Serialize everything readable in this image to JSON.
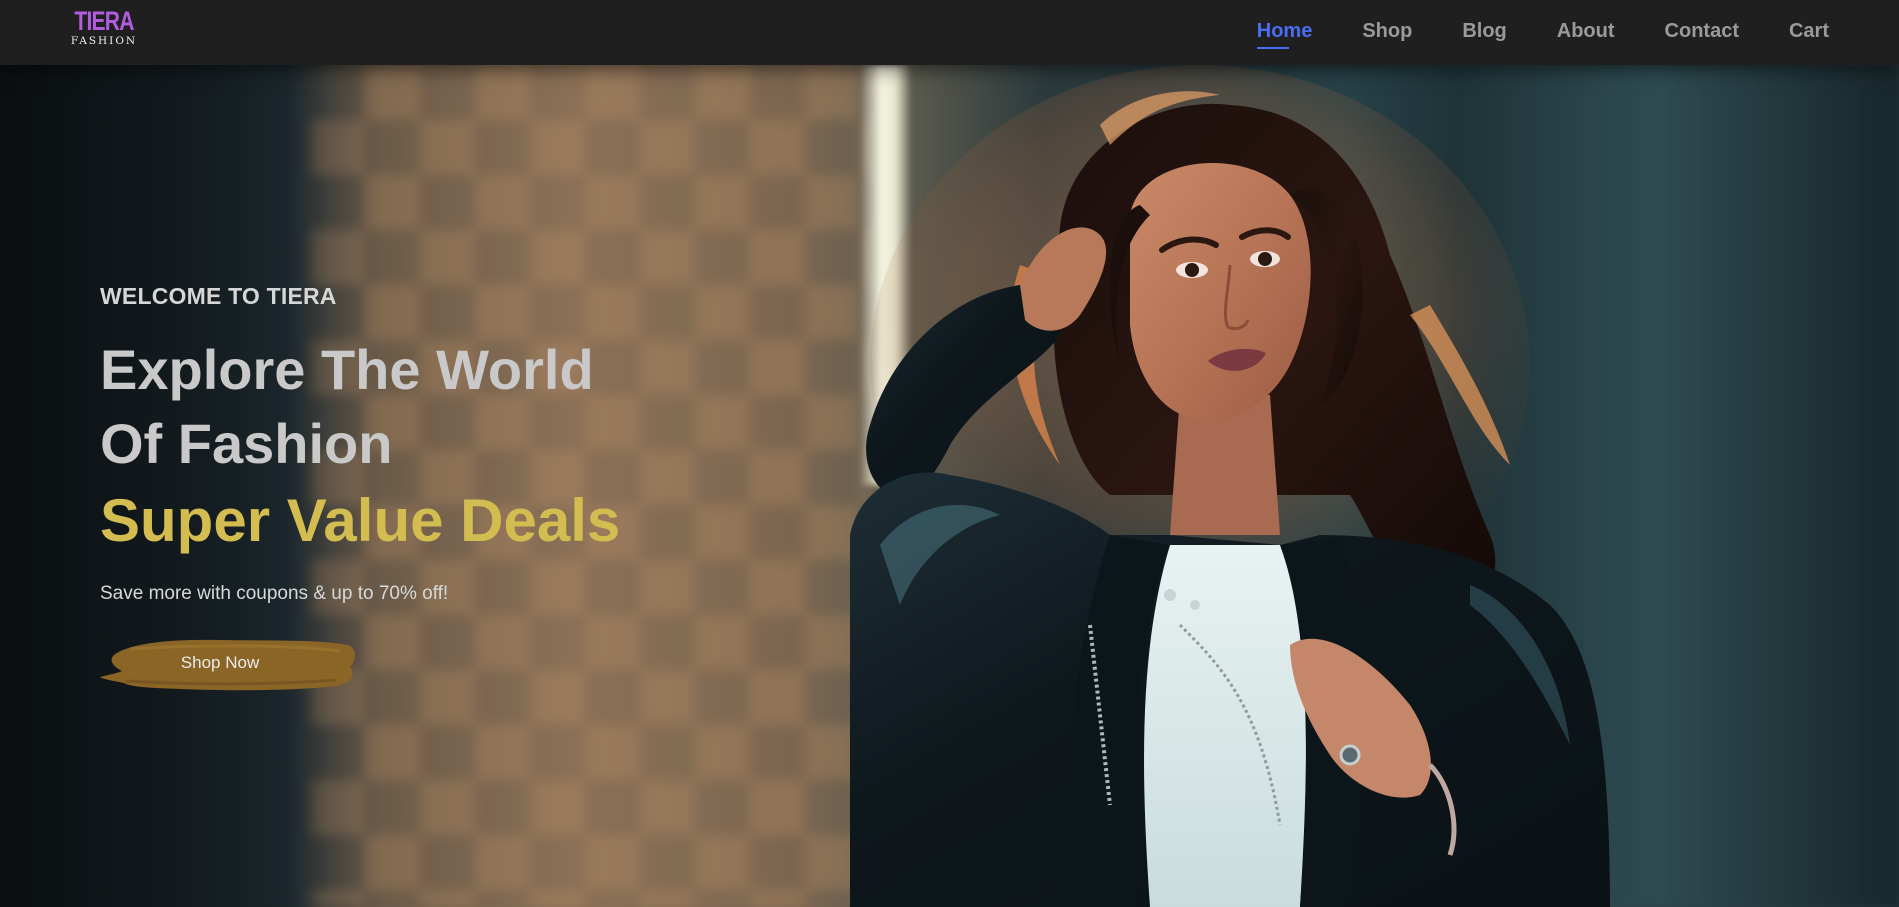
{
  "logo": {
    "main": "TIERA",
    "sub": "FASHION"
  },
  "nav": {
    "items": [
      {
        "label": "Home",
        "active": true
      },
      {
        "label": "Shop",
        "active": false
      },
      {
        "label": "Blog",
        "active": false
      },
      {
        "label": "About",
        "active": false
      },
      {
        "label": "Contact",
        "active": false
      },
      {
        "label": "Cart",
        "active": false
      }
    ]
  },
  "hero": {
    "eyebrow": "WELCOME TO TIERA",
    "headline_line1": "Explore The World",
    "headline_line2": "Of Fashion",
    "deals": "Super Value Deals",
    "subtext": "Save more with coupons & up to 70% off!",
    "cta_label": "Shop Now",
    "image": "fashion-model-photo"
  },
  "colors": {
    "header_bg": "#1f1f1f",
    "nav_active": "#4a6cf3",
    "nav_inactive": "#9a9a9a",
    "logo_accent": "#b05de0",
    "deals_text": "#d4bd50",
    "cta_brush": "#8a6526"
  }
}
